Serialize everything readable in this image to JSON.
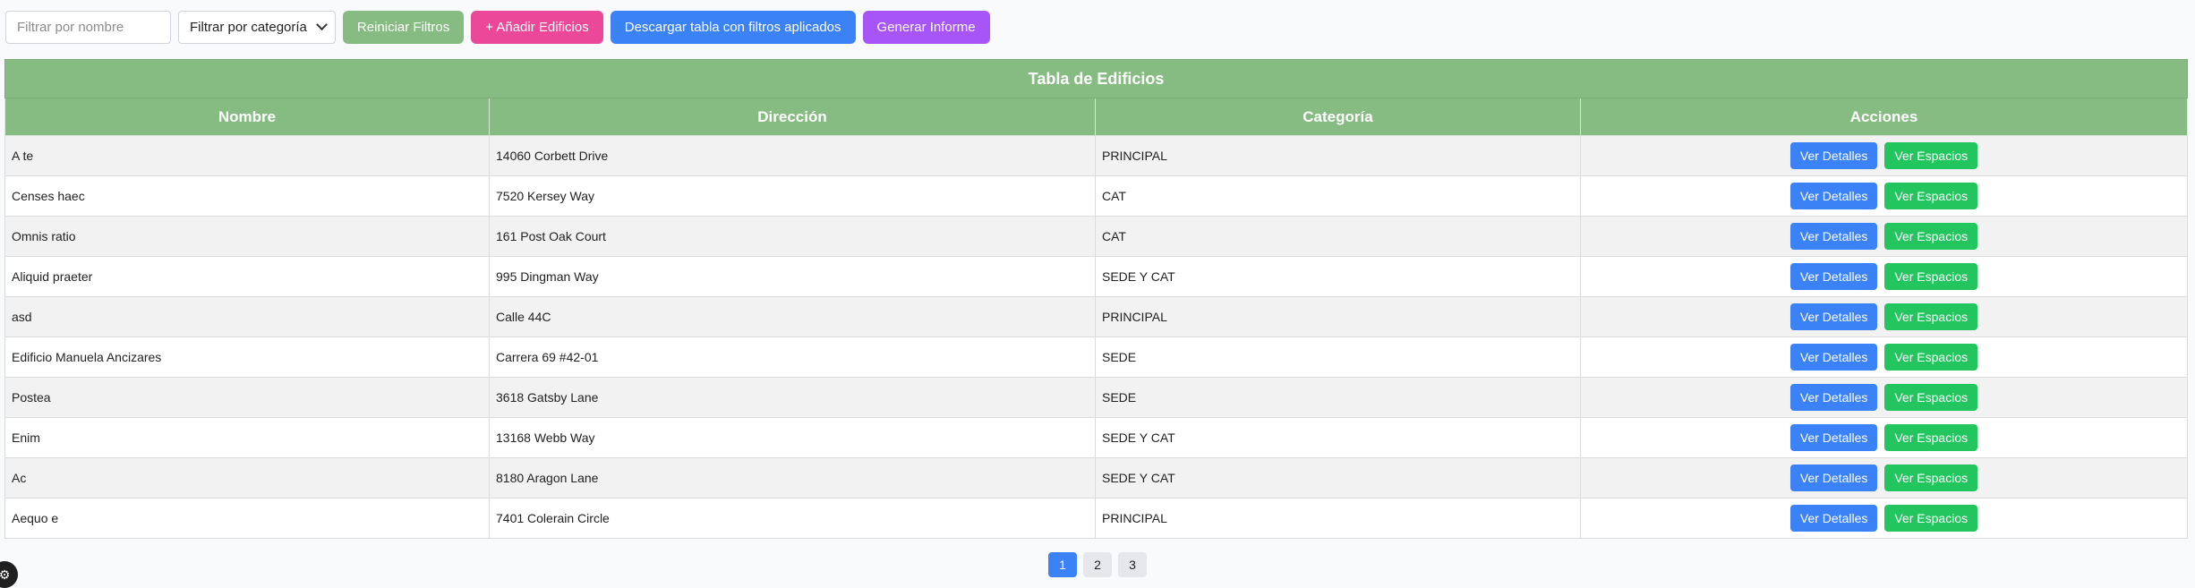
{
  "toolbar": {
    "name_filter_placeholder": "Filtrar por nombre",
    "category_filter_selected": "Filtrar por categoría",
    "reset_label": "Reiniciar Filtros",
    "add_label": "+ Añadir Edificios",
    "download_label": "Descargar tabla con filtros aplicados",
    "report_label": "Generar Informe"
  },
  "table": {
    "caption": "Tabla de Edificios",
    "headers": [
      "Nombre",
      "Dirección",
      "Categoría",
      "Acciones"
    ],
    "details_label": "Ver Detalles",
    "spaces_label": "Ver Espacios",
    "rows": [
      {
        "nombre": "A te",
        "direccion": "14060 Corbett Drive",
        "categoria": "PRINCIPAL"
      },
      {
        "nombre": "Censes haec",
        "direccion": "7520 Kersey Way",
        "categoria": "CAT"
      },
      {
        "nombre": "Omnis ratio",
        "direccion": "161 Post Oak Court",
        "categoria": "CAT"
      },
      {
        "nombre": "Aliquid praeter",
        "direccion": "995 Dingman Way",
        "categoria": "SEDE Y CAT"
      },
      {
        "nombre": "asd",
        "direccion": "Calle 44C",
        "categoria": "PRINCIPAL"
      },
      {
        "nombre": "Edificio Manuela Ancizares",
        "direccion": "Carrera 69 #42-01",
        "categoria": "SEDE"
      },
      {
        "nombre": "Postea",
        "direccion": "3618 Gatsby Lane",
        "categoria": "SEDE"
      },
      {
        "nombre": "Enim",
        "direccion": "13168 Webb Way",
        "categoria": "SEDE Y CAT"
      },
      {
        "nombre": "Ac",
        "direccion": "8180 Aragon Lane",
        "categoria": "SEDE Y CAT"
      },
      {
        "nombre": "Aequo e",
        "direccion": "7401 Colerain Circle",
        "categoria": "PRINCIPAL"
      }
    ]
  },
  "pagination": {
    "pages": [
      "1",
      "2",
      "3"
    ],
    "current": "1"
  },
  "icons": {
    "accessibility": "accessibility-icon",
    "dropdown": "chevron-down-icon"
  },
  "colors": {
    "header_green": "#86bc82",
    "details_blue": "#3b82f6",
    "spaces_green": "#22c55e",
    "add_pink": "#ec4899",
    "report_purple": "#a855f7"
  }
}
